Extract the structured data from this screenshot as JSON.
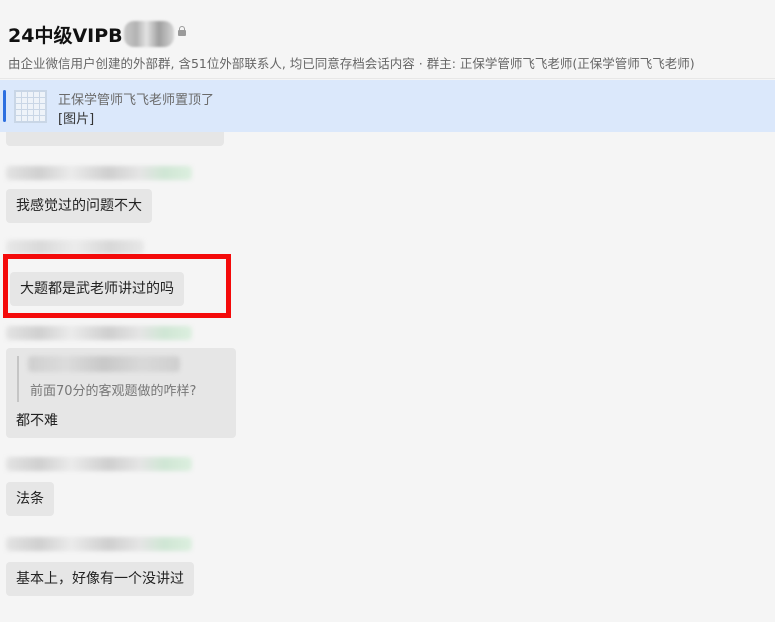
{
  "header": {
    "title": "24中级VIPB",
    "description": "由企业微信用户创建的外部群, 含51位外部联系人, 均已同意存档会话内容  · 群主: 正保学管师飞飞老师(正保学管师飞飞老师)"
  },
  "pinned": {
    "line1": "正保学管师飞飞老师置顶了",
    "line2": "[图片]"
  },
  "messages": {
    "m1": "我感觉过的问题不大",
    "m2": "大题都是武老师讲过的吗",
    "quote": {
      "quoted_text": "前面70分的客观题做的咋样?",
      "reply": "都不难"
    },
    "m3": "法条",
    "m4": "基本上，好像有一个没讲过"
  },
  "colors": {
    "highlight": "#f40a0a",
    "pinned_bg": "#dbe8fb",
    "accent": "#2d6fe0",
    "bubble_bg": "#e6e6e6"
  },
  "icons": {
    "title_lock": "lock-icon",
    "pinned_thumb": "image-thumbnail-icon"
  }
}
